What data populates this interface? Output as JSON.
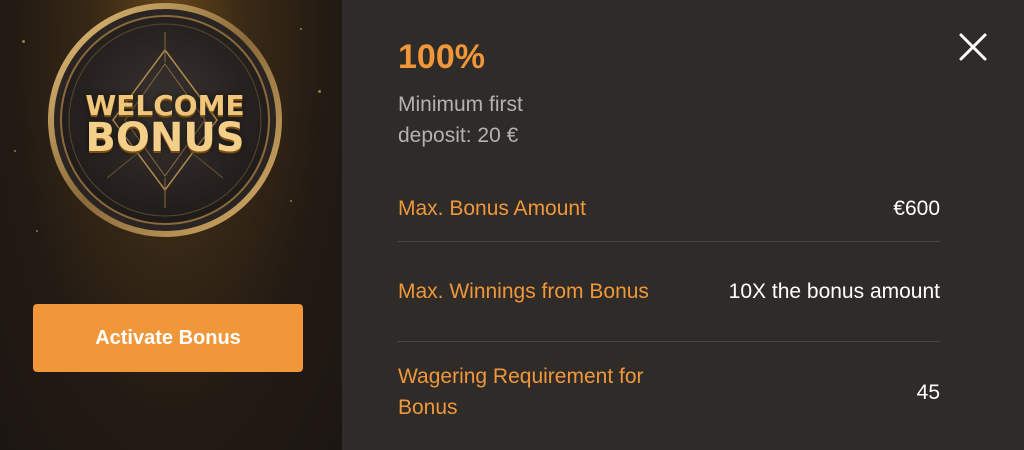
{
  "promo": {
    "image_line1": "WELCOME",
    "image_line2": "BONUS",
    "activate_label": "Activate Bonus"
  },
  "details": {
    "percent": "100%",
    "min_deposit": "Minimum first deposit: 20 €",
    "rows": [
      {
        "label": "Max. Bonus Amount",
        "value": "€600"
      },
      {
        "label": "Max. Winnings from Bonus",
        "value": "10X the bonus amount"
      },
      {
        "label": "Wagering Requirement for Bonus",
        "value": "45"
      }
    ]
  },
  "icons": {
    "close": "close-icon"
  },
  "colors": {
    "accent": "#f0973a",
    "panel_background": "#2f2b29",
    "text_muted": "#b5b1ae",
    "text_value": "#ffffff",
    "divider": "#4a4542"
  }
}
